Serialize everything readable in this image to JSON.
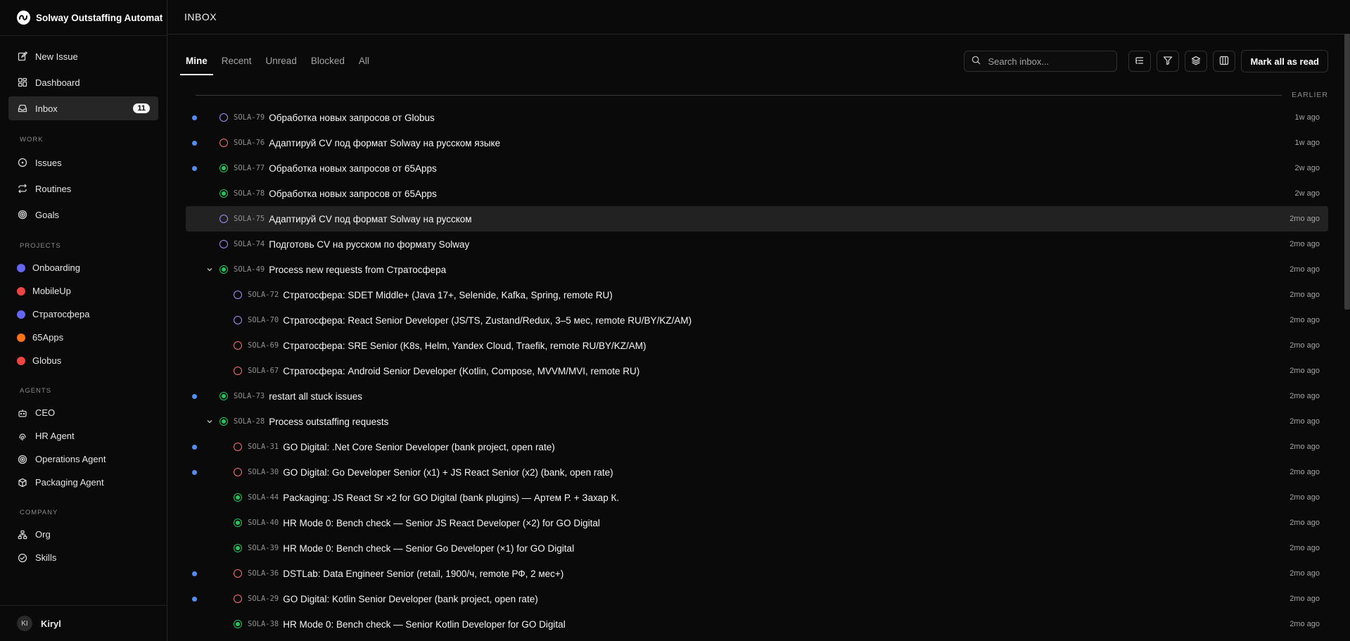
{
  "app": {
    "name": "Solway Outstaffing Automat"
  },
  "sidebar": {
    "main_items": [
      {
        "label": "New Issue",
        "icon": "edit-icon"
      },
      {
        "label": "Dashboard",
        "icon": "dashboard-icon"
      },
      {
        "label": "Inbox",
        "icon": "inbox-icon",
        "badge": "11",
        "active": true
      }
    ],
    "work_title": "WORK",
    "work_items": [
      {
        "label": "Issues",
        "icon": "circle-dot-icon"
      },
      {
        "label": "Routines",
        "icon": "repeat-icon"
      },
      {
        "label": "Goals",
        "icon": "target-icon"
      }
    ],
    "projects_title": "PROJECTS",
    "projects": [
      {
        "label": "Onboarding",
        "color": "#6366f1"
      },
      {
        "label": "MobileUp",
        "color": "#ef4444"
      },
      {
        "label": "Стратосфера",
        "color": "#6366f1"
      },
      {
        "label": "65Apps",
        "color": "#f97316"
      },
      {
        "label": "Globus",
        "color": "#ef4444"
      }
    ],
    "agents_title": "AGENTS",
    "agents": [
      {
        "label": "CEO",
        "icon": "bot-icon"
      },
      {
        "label": "HR Agent",
        "icon": "fingerprint-icon"
      },
      {
        "label": "Operations Agent",
        "icon": "radar-icon"
      },
      {
        "label": "Packaging Agent",
        "icon": "package-icon"
      }
    ],
    "company_title": "COMPANY",
    "company": [
      {
        "label": "Org",
        "icon": "org-icon"
      },
      {
        "label": "Skills",
        "icon": "skills-icon"
      }
    ],
    "user": {
      "initials": "KI",
      "name": "Kiryl"
    }
  },
  "header": {
    "title": "INBOX"
  },
  "tabs": [
    "Mine",
    "Recent",
    "Unread",
    "Blocked",
    "All"
  ],
  "search": {
    "placeholder": "Search inbox..."
  },
  "toolbar": {
    "mark_all": "Mark all as read"
  },
  "group": {
    "label": "EARLIER"
  },
  "colors": {
    "todo": "#a78bfa",
    "backlog": "#f87171",
    "done": "#22c55e",
    "unread": "#4f8ff7"
  },
  "rows": [
    {
      "id": "SOLA-79",
      "title": "Обработка новых запросов от Globus",
      "time": "1w ago",
      "status": "todo",
      "unread": true,
      "indent": 0
    },
    {
      "id": "SOLA-76",
      "title": "Адаптируй CV под формат Solway на русском языке",
      "time": "1w ago",
      "status": "backlog",
      "unread": true,
      "indent": 0
    },
    {
      "id": "SOLA-77",
      "title": "Обработка новых запросов от 65Apps",
      "time": "2w ago",
      "status": "done",
      "unread": true,
      "indent": 0
    },
    {
      "id": "SOLA-78",
      "title": "Обработка новых запросов от 65Apps",
      "time": "2w ago",
      "status": "done",
      "unread": false,
      "indent": 0
    },
    {
      "id": "SOLA-75",
      "title": "Адаптируй CV под формат Solway на русском",
      "time": "2mo ago",
      "status": "todo",
      "unread": false,
      "indent": 0,
      "hover": true
    },
    {
      "id": "SOLA-74",
      "title": "Подготовь CV на русском по формату Solway",
      "time": "2mo ago",
      "status": "todo",
      "unread": false,
      "indent": 0
    },
    {
      "id": "SOLA-49",
      "title": "Process new requests from Стратосфера",
      "time": "2mo ago",
      "status": "done",
      "unread": false,
      "indent": 0,
      "expanded": true
    },
    {
      "id": "SOLA-72",
      "title": "Стратосфера: SDET Middle+ (Java 17+, Selenide, Kafka, Spring, remote RU)",
      "time": "2mo ago",
      "status": "todo",
      "unread": false,
      "indent": 1
    },
    {
      "id": "SOLA-70",
      "title": "Стратосфера: React Senior Developer (JS/TS, Zustand/Redux, 3–5 мес, remote RU/BY/KZ/AM)",
      "time": "2mo ago",
      "status": "todo",
      "unread": false,
      "indent": 1
    },
    {
      "id": "SOLA-69",
      "title": "Стратосфера: SRE Senior (K8s, Helm, Yandex Cloud, Traefik, remote RU/BY/KZ/AM)",
      "time": "2mo ago",
      "status": "backlog",
      "unread": false,
      "indent": 1
    },
    {
      "id": "SOLA-67",
      "title": "Стратосфера: Android Senior Developer (Kotlin, Compose, MVVM/MVI, remote RU)",
      "time": "2mo ago",
      "status": "backlog",
      "unread": false,
      "indent": 1
    },
    {
      "id": "SOLA-73",
      "title": "restart all stuck issues",
      "time": "2mo ago",
      "status": "done",
      "unread": true,
      "indent": 0
    },
    {
      "id": "SOLA-28",
      "title": "Process outstaffing requests",
      "time": "2mo ago",
      "status": "done",
      "unread": false,
      "indent": 0,
      "expanded": true
    },
    {
      "id": "SOLA-31",
      "title": "GO Digital: .Net Core Senior Developer (bank project, open rate)",
      "time": "2mo ago",
      "status": "backlog",
      "unread": true,
      "indent": 1
    },
    {
      "id": "SOLA-30",
      "title": "GO Digital: Go Developer Senior (x1) + JS React Senior (x2) (bank, open rate)",
      "time": "2mo ago",
      "status": "backlog",
      "unread": true,
      "indent": 1
    },
    {
      "id": "SOLA-44",
      "title": "Packaging: JS React Sr ×2 for GO Digital (bank plugins) — Артем Р. + Захар К.",
      "time": "2mo ago",
      "status": "done",
      "unread": false,
      "indent": 1
    },
    {
      "id": "SOLA-40",
      "title": "HR Mode 0: Bench check — Senior JS React Developer (×2) for GO Digital",
      "time": "2mo ago",
      "status": "done",
      "unread": false,
      "indent": 1
    },
    {
      "id": "SOLA-39",
      "title": "HR Mode 0: Bench check — Senior Go Developer (×1) for GO Digital",
      "time": "2mo ago",
      "status": "done",
      "unread": false,
      "indent": 1
    },
    {
      "id": "SOLA-36",
      "title": "DSTLab: Data Engineer Senior (retail, 1900/ч, remote РФ, 2 мес+)",
      "time": "2mo ago",
      "status": "backlog",
      "unread": true,
      "indent": 1
    },
    {
      "id": "SOLA-29",
      "title": "GO Digital: Kotlin Senior Developer (bank project, open rate)",
      "time": "2mo ago",
      "status": "backlog",
      "unread": true,
      "indent": 1
    },
    {
      "id": "SOLA-38",
      "title": "HR Mode 0: Bench check — Senior Kotlin Developer for GO Digital",
      "time": "2mo ago",
      "status": "done",
      "unread": false,
      "indent": 1
    }
  ]
}
